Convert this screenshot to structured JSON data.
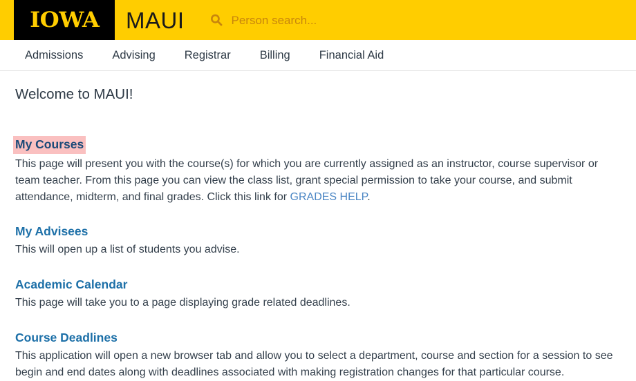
{
  "header": {
    "logo_text": "IOWA",
    "app_title": "MAUI",
    "search": {
      "icon": "search-icon",
      "placeholder": "Person search..."
    },
    "background_color": "#ffcd00",
    "logo_block_color": "#000000"
  },
  "nav": {
    "items": [
      {
        "label": "Admissions"
      },
      {
        "label": "Advising"
      },
      {
        "label": "Registrar"
      },
      {
        "label": "Billing"
      },
      {
        "label": "Financial Aid"
      }
    ]
  },
  "main": {
    "page_title": "Welcome to MAUI!",
    "sections": [
      {
        "heading": "My Courses",
        "highlighted": true,
        "highlight_color": "#fac0c0",
        "body_before_link": "This page will present you with the course(s) for which you are currently assigned as an instructor, course supervisor or team teacher. From this page you can view the class list, grant special permission to take your course, and submit attendance, midterm, and final grades. Click this link for ",
        "link_text": "GRADES HELP",
        "body_after_link": "."
      },
      {
        "heading": "My Advisees",
        "highlighted": false,
        "body": "This will open up a list of students you advise."
      },
      {
        "heading": "Academic Calendar",
        "highlighted": false,
        "body": "This page will take you to a page displaying grade related deadlines."
      },
      {
        "heading": "Course Deadlines",
        "highlighted": false,
        "body": "This application will open a new browser tab and allow you to select a department, course and section for a session to see begin and end dates along with deadlines associated with making registration changes for that particular course."
      }
    ]
  },
  "colors": {
    "brand_yellow": "#ffcd00",
    "link_blue": "#1d70a8",
    "inline_link_blue": "#4b86c4",
    "text_gray": "#333f4b",
    "selection_pink": "#fac0c0"
  }
}
